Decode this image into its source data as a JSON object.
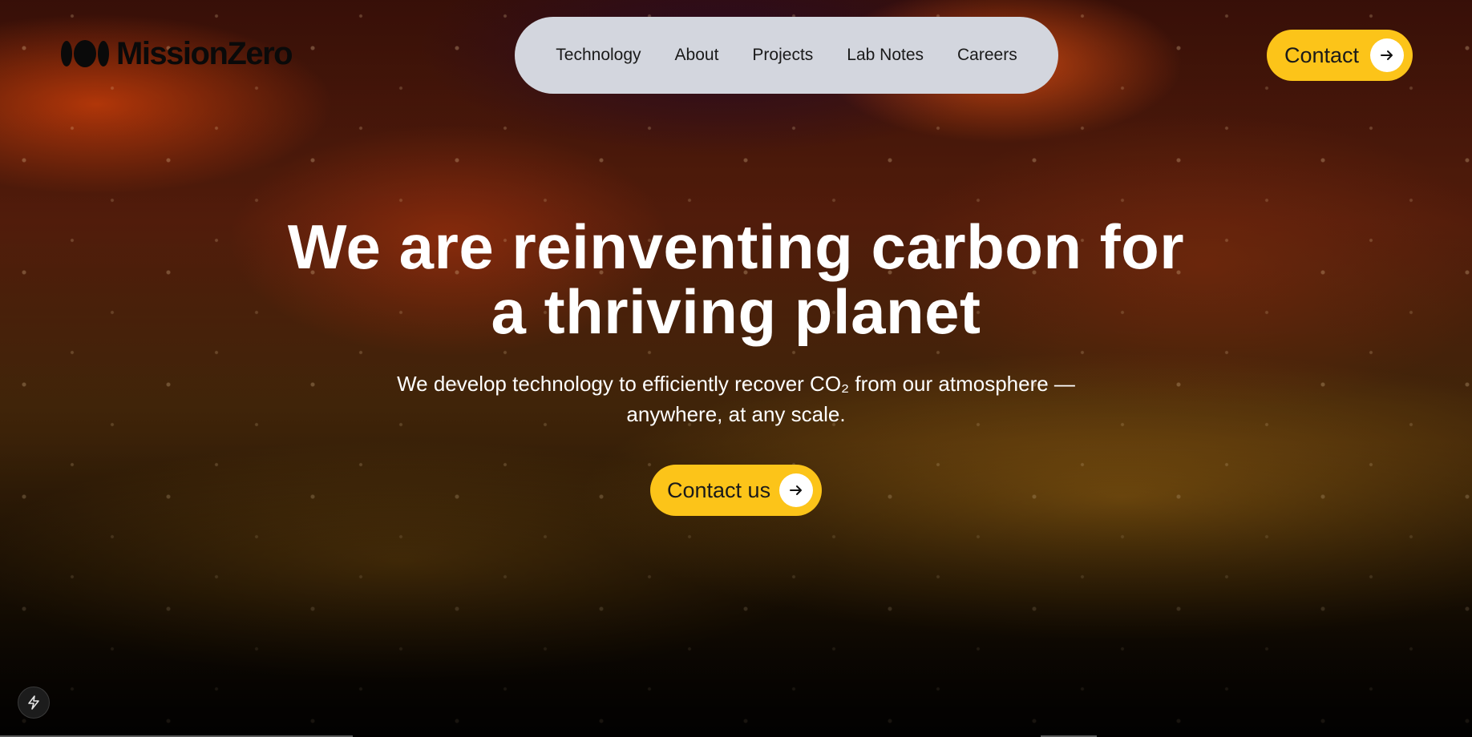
{
  "brand": {
    "name": "MissionZero",
    "logo_icon": "mission-zero-logo-icon"
  },
  "nav": {
    "items": [
      {
        "label": "Technology"
      },
      {
        "label": "About"
      },
      {
        "label": "Projects"
      },
      {
        "label": "Lab Notes"
      },
      {
        "label": "Careers"
      }
    ]
  },
  "header_cta": {
    "label": "Contact",
    "icon": "arrow-right-icon"
  },
  "hero": {
    "title_line1": "We are reinventing carbon for",
    "title_line2": "a thriving planet",
    "subtitle_line1": "We develop technology to efficiently recover CO₂ from our atmosphere —",
    "subtitle_line2": "anywhere, at any scale.",
    "cta_label": "Contact us",
    "cta_icon": "arrow-right-icon"
  },
  "badge": {
    "icon": "lightning-bolt-icon"
  },
  "colors": {
    "accent": "#fcc419",
    "nav_bg": "#d3d6de",
    "text_dark": "#1a1a1a",
    "text_light": "#ffffff"
  }
}
